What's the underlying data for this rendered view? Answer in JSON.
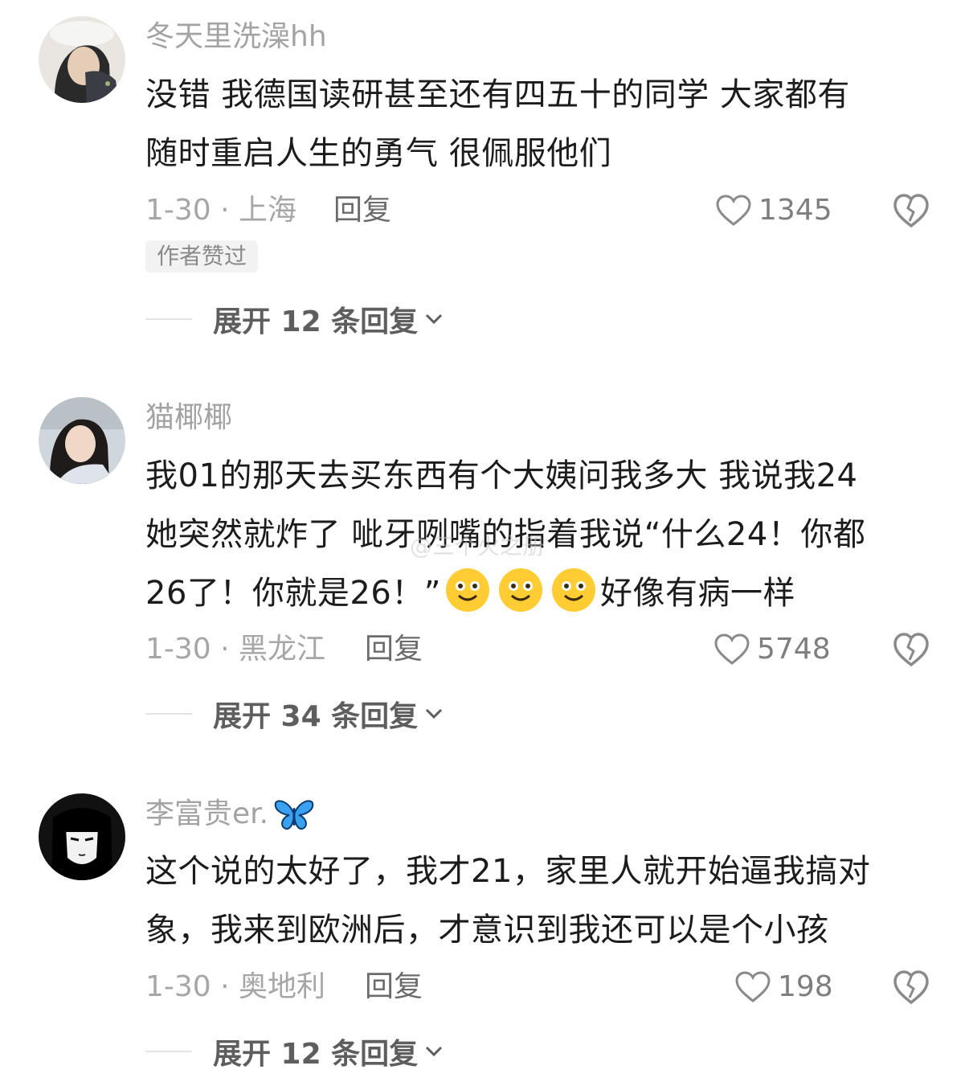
{
  "comments": [
    {
      "username": "冬天里洗澡hh",
      "text_line1": "没错 我德国读研甚至还有四五十的同学 大家都有",
      "text_line2": "随时重启人生的勇气 很佩服他们",
      "date_location": "1-30 · 上海",
      "reply_label": "回复",
      "likes": "1345",
      "badge": "作者赞过",
      "expand_label": "展开 12 条回复"
    },
    {
      "username": "猫椰椰",
      "text_line1": "我01的那天去买东西有个大姨问我多大 我说我24",
      "text_line2": "她突然就炸了 呲牙咧嘴的指着我说“什么24！你都",
      "text_line3_before": "26了！你就是26！”",
      "text_line3_after": "好像有病一样",
      "emojis": [
        "smile-emoji",
        "smile-emoji",
        "smile-emoji"
      ],
      "date_location": "1-30 · 黑龙江",
      "reply_label": "回复",
      "likes": "5748",
      "expand_label": "展开 34 条回复"
    },
    {
      "username": "李富贵er.",
      "username_icon": "butterfly-icon",
      "text_line1": "这个说的太好了，我才21，家里人就开始逼我搞对",
      "text_line2": "象，我来到欧洲后，才意识到我还可以是个小孩",
      "date_location": "1-30 · 奥地利",
      "reply_label": "回复",
      "likes": "198",
      "expand_label": "展开 12 条回复"
    }
  ],
  "watermark": "@三个火之册",
  "colors": {
    "username": "#a3a3a3",
    "body": "#1c1c1c",
    "meta": "#a6a6a6",
    "badge_bg": "#f2f2f2"
  }
}
